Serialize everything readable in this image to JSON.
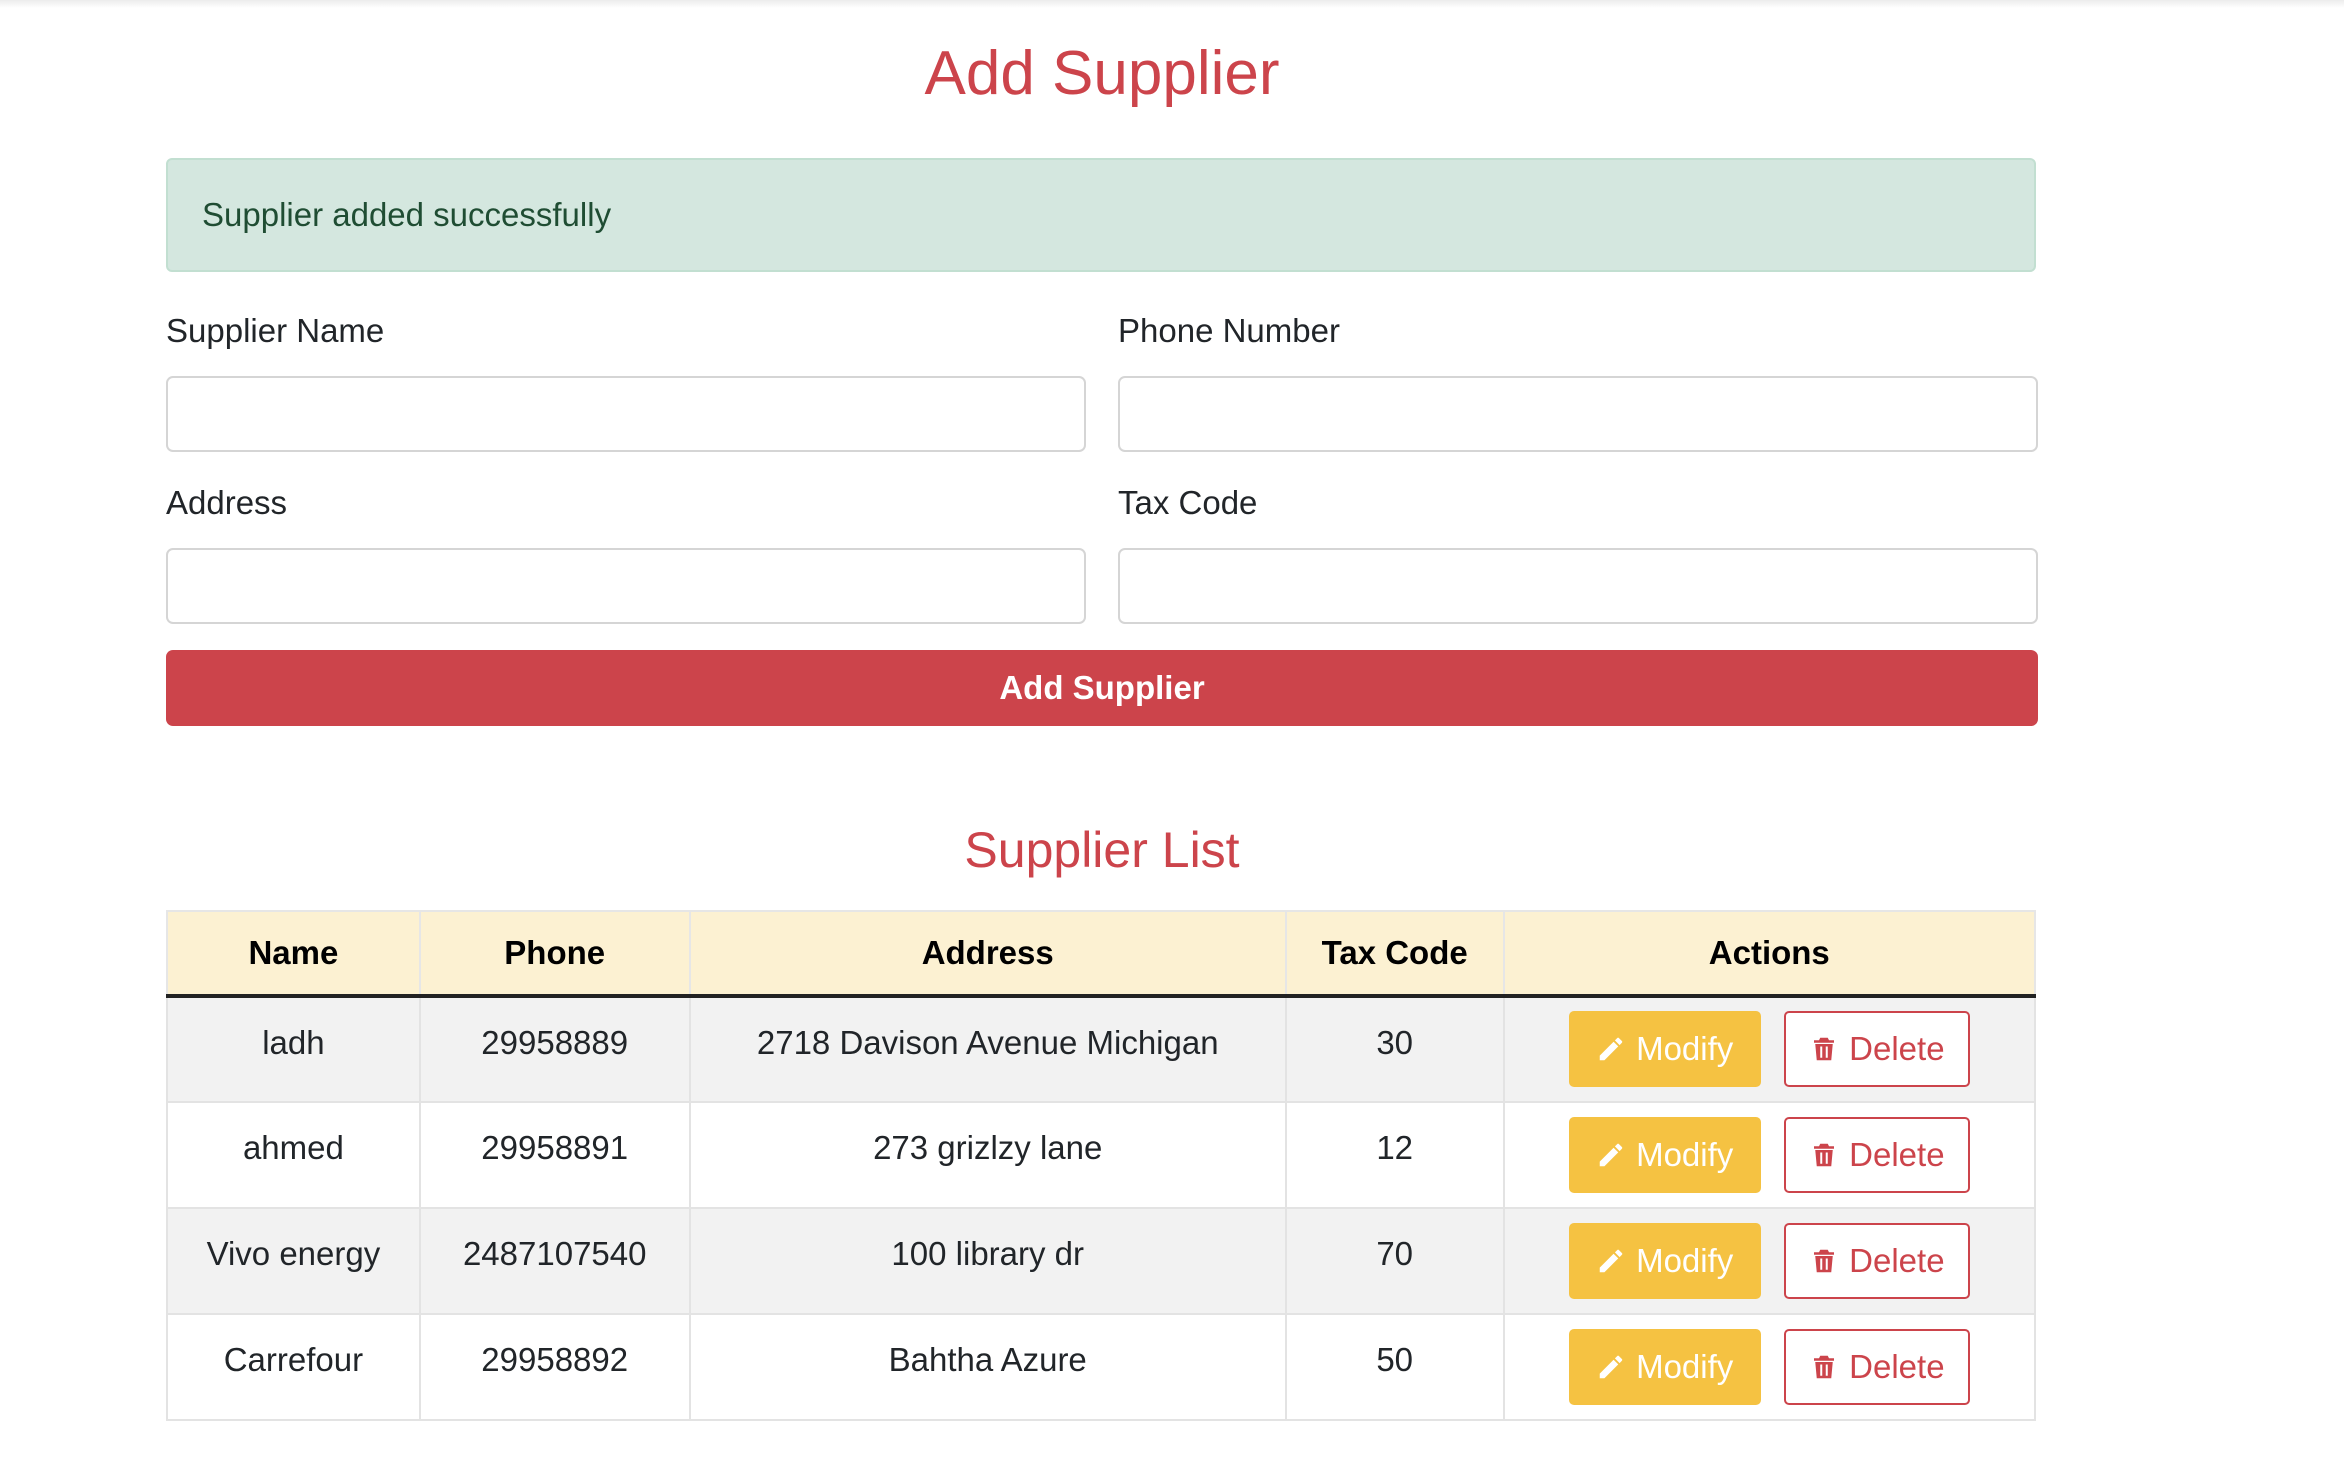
{
  "page": {
    "title": "Add Supplier"
  },
  "alert": {
    "message": "Supplier added successfully"
  },
  "form": {
    "supplier_name_label": "Supplier Name",
    "supplier_name_value": "",
    "phone_label": "Phone Number",
    "phone_value": "",
    "address_label": "Address",
    "address_value": "",
    "tax_code_label": "Tax Code",
    "tax_code_value": "",
    "submit_label": "Add Supplier"
  },
  "list": {
    "title": "Supplier List",
    "columns": [
      "Name",
      "Phone",
      "Address",
      "Tax Code",
      "Actions"
    ],
    "modify_label": "Modify",
    "delete_label": "Delete",
    "rows": [
      {
        "name": "ladh",
        "phone": "29958889",
        "address": "2718 Davison Avenue Michigan",
        "tax_code": "30"
      },
      {
        "name": "ahmed",
        "phone": "29958891",
        "address": "273 grizlzy lane",
        "tax_code": "12"
      },
      {
        "name": "Vivo energy",
        "phone": "2487107540",
        "address": "100 library dr",
        "tax_code": "70"
      },
      {
        "name": "Carrefour",
        "phone": "29958892",
        "address": "Bahtha Azure",
        "tax_code": "50"
      }
    ]
  },
  "icons": {
    "modify": "pencil-icon",
    "delete": "trash-icon"
  },
  "colors": {
    "accent": "#cc444b",
    "alert_bg": "#d4e7df",
    "header_bg": "#fcf1d2",
    "modify_bg": "#f5c242"
  }
}
